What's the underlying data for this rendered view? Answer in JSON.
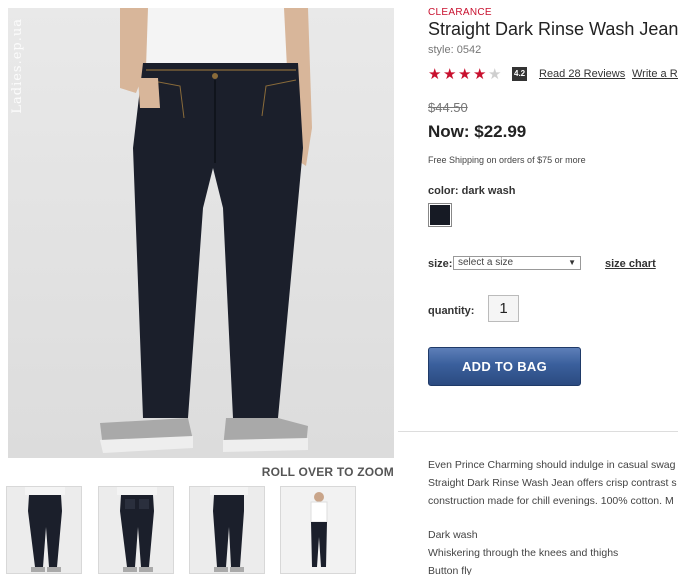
{
  "product": {
    "clearance_label": "CLEARANCE",
    "title": "Straight Dark Rinse Wash Jean",
    "style": "style: 0542",
    "rating": 4.2,
    "rating_badge": "4.2",
    "stars_filled": 4,
    "stars_total": 5,
    "reviews_link": "Read 28 Reviews",
    "write_review_link": "Write a Re",
    "old_price": "$44.50",
    "now_price": "Now: $22.99",
    "shipping_note": "Free Shipping on orders of $75 or more",
    "color_label": "color: dark wash",
    "swatch_color": "#161a24",
    "size_label": "size:",
    "size_select_value": "select a size",
    "size_chart_link": "size chart",
    "quantity_label": "quantity:",
    "quantity_value": "1",
    "add_to_bag": "ADD TO BAG",
    "accent_color": "#c8102e",
    "button_color": "#3a5f9c"
  },
  "gallery": {
    "watermark": "Ladies.ep.ua",
    "zoom_label": "ROLL OVER TO ZOOM",
    "thumbnails": [
      "front-view",
      "back-view",
      "side-view",
      "full-outfit"
    ]
  },
  "description": {
    "lines": [
      "Even Prince Charming should indulge in casual swag",
      "Straight Dark Rinse Wash Jean offers crisp contrast s",
      "construction made for chill evenings. 100% cotton. M"
    ],
    "bullets": [
      "Dark wash",
      "Whiskering through the knees and thighs",
      "Button fly"
    ]
  }
}
